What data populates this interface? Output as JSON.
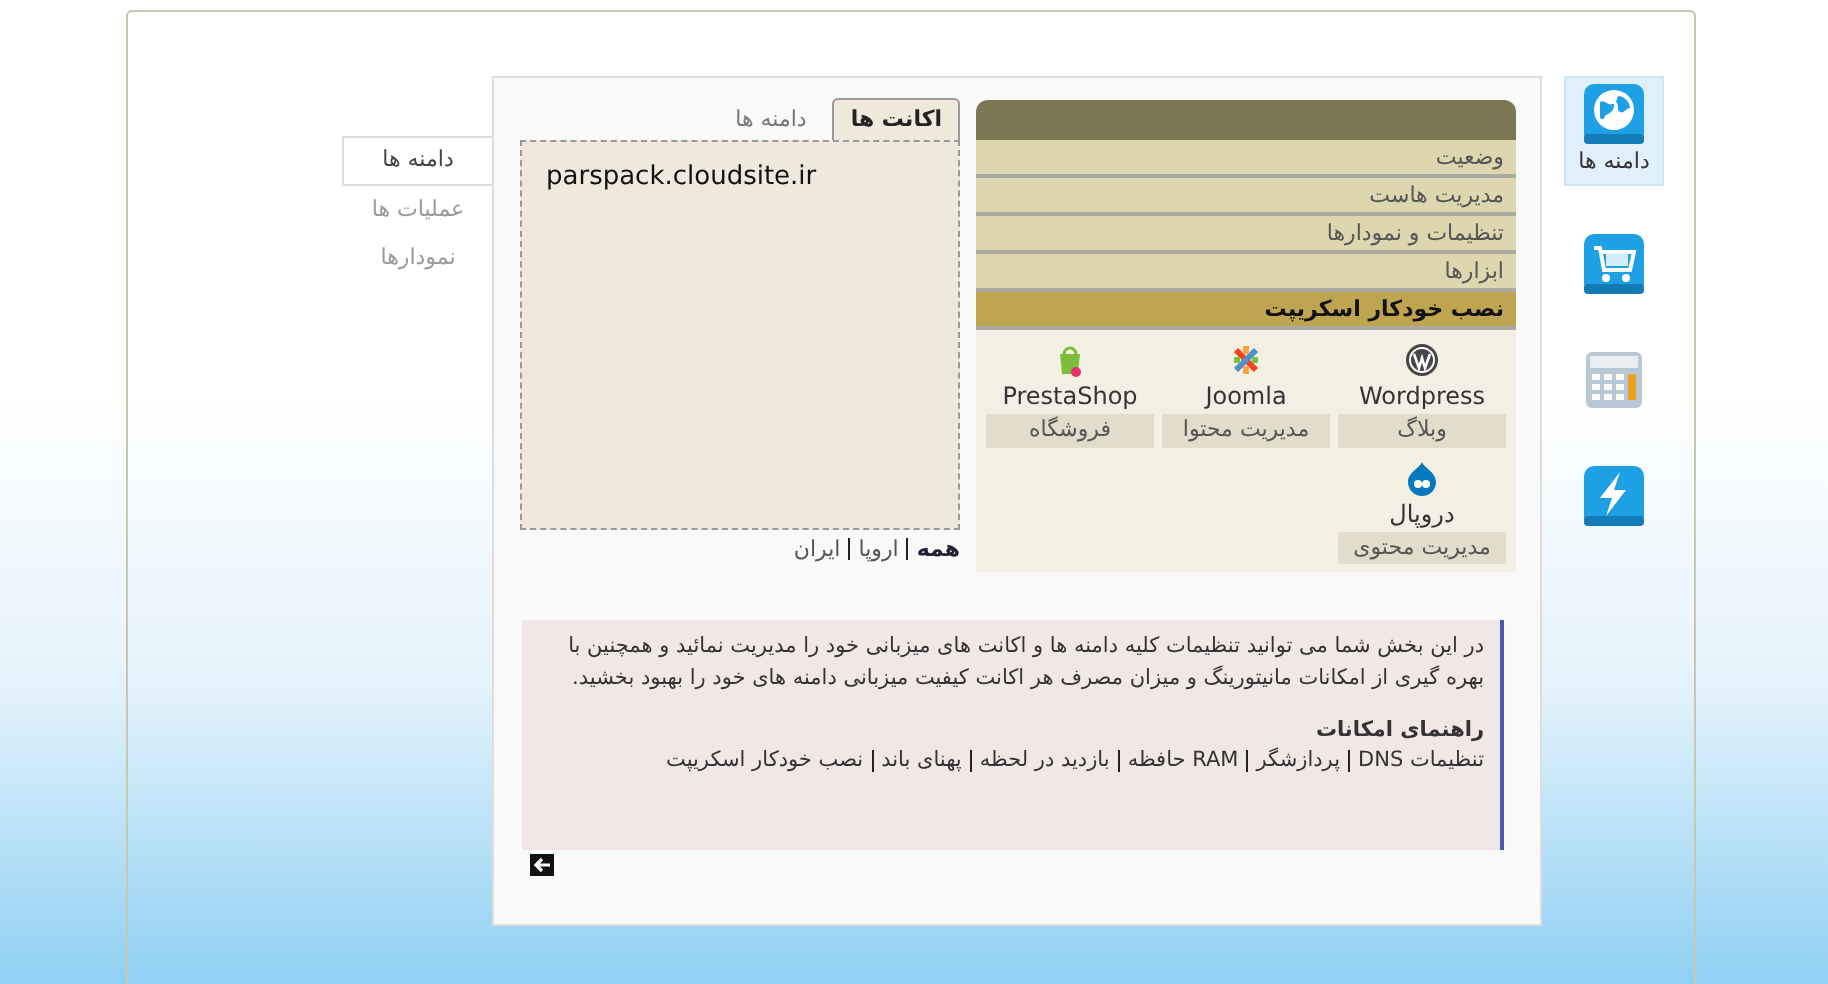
{
  "icon_bar": [
    {
      "kind": "globe",
      "label": "دامنه ها",
      "selected": true
    },
    {
      "kind": "cart",
      "selected": false
    },
    {
      "kind": "calculator",
      "selected": false
    },
    {
      "kind": "lightning",
      "selected": false
    }
  ],
  "side_nav": [
    {
      "label": "دامنه ها",
      "selected": true
    },
    {
      "label": "عملیات ها",
      "selected": false
    },
    {
      "label": "نمودارها",
      "selected": false
    }
  ],
  "tabs": [
    {
      "label": "اکانت ها",
      "selected": true
    },
    {
      "label": "دامنه ها",
      "selected": false
    }
  ],
  "accounts": [
    "parspack.cloudsite.ir"
  ],
  "filters": [
    {
      "label": "همه",
      "selected": true
    },
    {
      "label": "اروپا",
      "selected": false
    },
    {
      "label": "ایران",
      "selected": false
    }
  ],
  "menu": [
    {
      "label": "وضعیت",
      "selected": false
    },
    {
      "label": "مدیریت هاست",
      "selected": false
    },
    {
      "label": "تنظیمات و نمودارها",
      "selected": false
    },
    {
      "label": "ابزارها",
      "selected": false
    },
    {
      "label": "نصب خودکار اسکریپت",
      "selected": true
    }
  ],
  "scripts": [
    {
      "kind": "wordpress",
      "name": "Wordpress",
      "category": "وبلاگ"
    },
    {
      "kind": "joomla",
      "name": "Joomla",
      "category": "مدیریت محتوا"
    },
    {
      "kind": "prestashop",
      "name": "PrestaShop",
      "category": "فروشگاه"
    },
    {
      "kind": "drupal",
      "name": "دروپال",
      "category": "مدیریت محتوی"
    }
  ],
  "info": {
    "text": "در این بخش شما می توانید تنظیمات کلیه دامنه ها و اکانت های میزبانی خود را مدیریت نمائید و همچنین با بهره گیری از امکانات مانیتورینگ و میزان مصرف هر اکانت کیفیت میزبانی دامنه های خود را بهبود بخشید.",
    "heading": "راهنمای امکانات",
    "links": [
      "تنظیمات DNS",
      "پردازشگر",
      "RAM حافظه",
      "بازدید در لحظه",
      "پهنای باند",
      "نصب خودکار اسکریپت"
    ]
  }
}
